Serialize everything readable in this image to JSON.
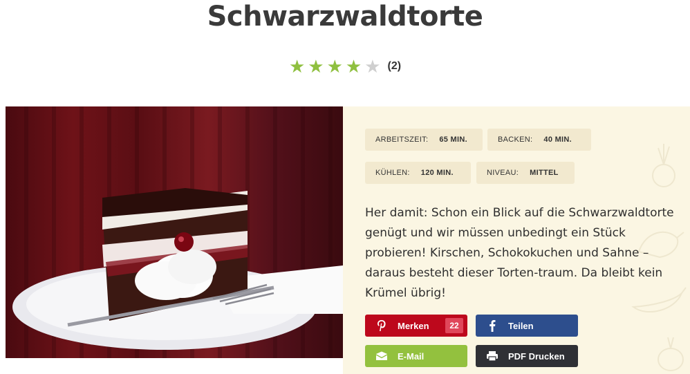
{
  "recipe": {
    "title": "Schwarzwaldtorte",
    "rating": {
      "value": 4,
      "max": 5,
      "count_label": "(2)"
    },
    "info": [
      {
        "label": "ARBEITSZEIT:",
        "value": "65 MIN."
      },
      {
        "label": "BACKEN:",
        "value": "40 MIN."
      },
      {
        "label": "KÜHLEN:",
        "value": "120 MIN."
      },
      {
        "label": "NIVEAU:",
        "value": "MITTEL"
      }
    ],
    "description": "Her damit: Schon ein Blick auf die Schwarzwaldtorte genügt und wir müssen unbedingt ein Stück probieren! Kirschen, Schokokuchen und Sahne – daraus besteht dieser Torten-traum. Da bleibt kein Krümel übrig!"
  },
  "share": {
    "pinterest": {
      "label": "Merken",
      "count": "22",
      "icon": "pinterest-icon",
      "color": "#bd081c"
    },
    "facebook": {
      "label": "Teilen",
      "icon": "facebook-icon",
      "color": "#2d4e8d"
    },
    "email": {
      "label": "E-Mail",
      "icon": "envelope-icon",
      "color": "#93c13e"
    },
    "pdf": {
      "label": "PDF Drucken",
      "icon": "printer-icon",
      "color": "#2f3035"
    }
  },
  "colors": {
    "star_full": "#8fc03f",
    "star_empty": "#cfcfcf",
    "panel_bg": "#fbf6e3",
    "chip_bg": "#f2e9cf"
  }
}
